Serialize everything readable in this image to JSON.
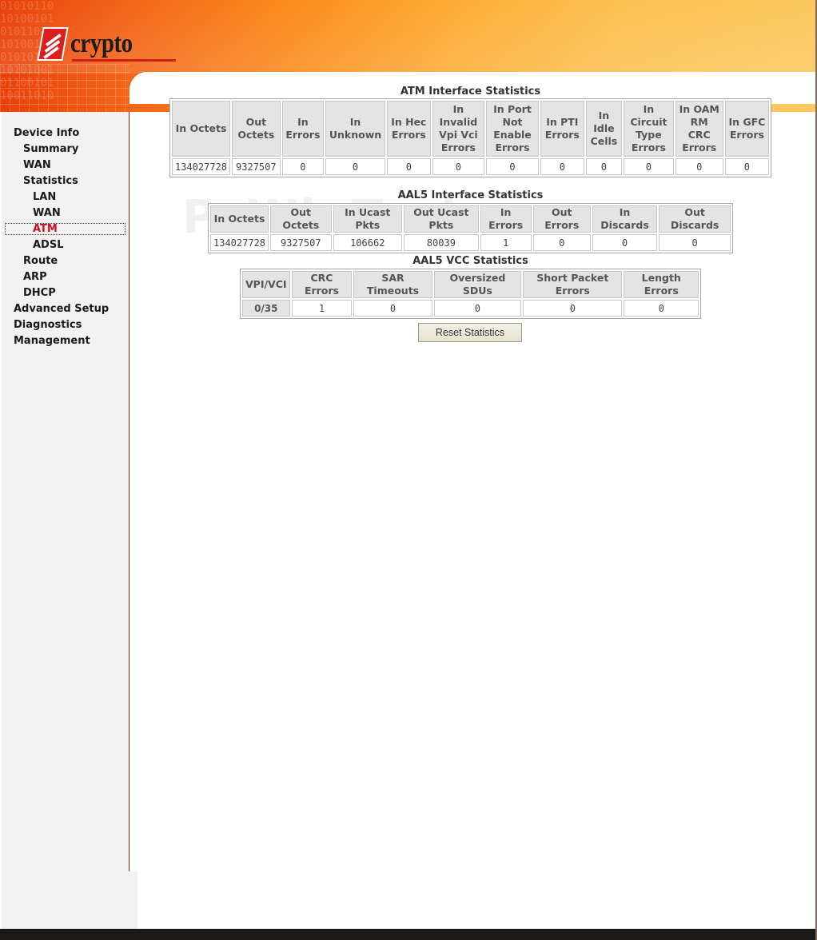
{
  "brand": {
    "logo_text": "crypto"
  },
  "sidebar": {
    "items": [
      {
        "label": "Device Info",
        "level": 0
      },
      {
        "label": "Summary",
        "level": 1
      },
      {
        "label": "WAN",
        "level": 1
      },
      {
        "label": "Statistics",
        "level": 1
      },
      {
        "label": "LAN",
        "level": 2
      },
      {
        "label": "WAN",
        "level": 2
      },
      {
        "label": "ATM",
        "level": 2,
        "active": true
      },
      {
        "label": "ADSL",
        "level": 2
      },
      {
        "label": "Route",
        "level": 1
      },
      {
        "label": "ARP",
        "level": 1
      },
      {
        "label": "DHCP",
        "level": 1
      },
      {
        "label": "Advanced Setup",
        "level": 0
      },
      {
        "label": "Diagnostics",
        "level": 0
      },
      {
        "label": "Management",
        "level": 0
      }
    ]
  },
  "atm_interface": {
    "title": "ATM Interface Statistics",
    "headers": [
      "In Octets",
      "Out Octets",
      "In Errors",
      "In Unknown",
      "In Hec Errors",
      "In Invalid Vpi Vci Errors",
      "In Port Not Enable Errors",
      "In PTI Errors",
      "In Idle Cells",
      "In Circuit Type Errors",
      "In OAM RM CRC Errors",
      "In GFC Errors"
    ],
    "values": [
      "134027728",
      "9327507",
      "0",
      "0",
      "0",
      "0",
      "0",
      "0",
      "0",
      "0",
      "0",
      "0"
    ]
  },
  "aal5_interface": {
    "title": "AAL5 Interface Statistics",
    "headers": [
      "In Octets",
      "Out Octets",
      "In Ucast Pkts",
      "Out Ucast Pkts",
      "In Errors",
      "Out Errors",
      "In Discards",
      "Out Discards"
    ],
    "values": [
      "134027728",
      "9327507",
      "106662",
      "80039",
      "1",
      "0",
      "0",
      "0"
    ]
  },
  "aal5_vcc": {
    "title": "AAL5 VCC Statistics",
    "headers": [
      "VPI/VCI",
      "CRC Errors",
      "SAR Timeouts",
      "Oversized SDUs",
      "Short Packet Errors",
      "Length Errors"
    ],
    "row_label": "0/35",
    "values": [
      "1",
      "0",
      "0",
      "0",
      "0"
    ]
  },
  "reset_button": {
    "label": "Reset Statistics"
  },
  "watermark": {
    "text": "PcWinTech.com"
  }
}
